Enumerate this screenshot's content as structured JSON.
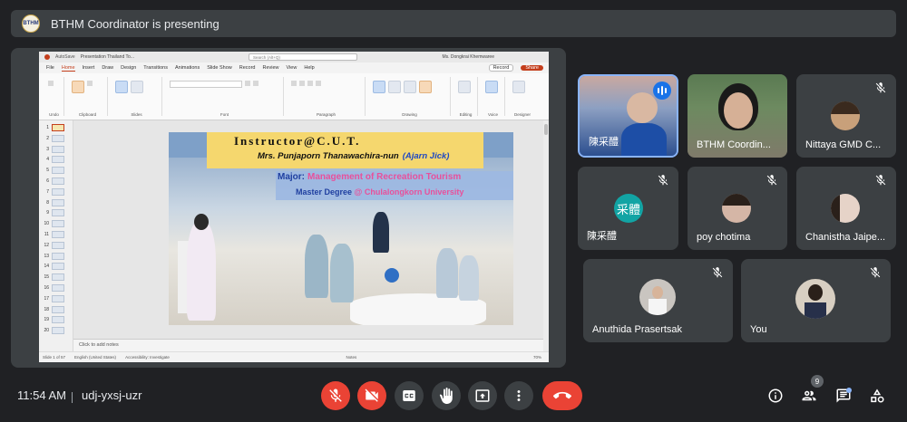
{
  "presenter": {
    "text": "BTHM Coordinator is presenting",
    "avatar_text": "BTHM"
  },
  "powerpoint": {
    "autosave": "AutoSave",
    "file_title": "Presentation Thailand To...",
    "search_placeholder": "Search (Alt+Q)",
    "user": "Ms. Dongkrai Khemwaree",
    "menu": [
      "File",
      "Home",
      "Insert",
      "Draw",
      "Design",
      "Transitions",
      "Animations",
      "Slide Show",
      "Record",
      "Review",
      "View",
      "Help"
    ],
    "active_menu": "Home",
    "record_label": "Record",
    "share_label": "Share",
    "ribbon_groups": [
      "Undo",
      "Clipboard",
      "Slides",
      "Font",
      "Paragraph",
      "Drawing",
      "Editing",
      "Voice",
      "Designer"
    ],
    "slide_numbers": [
      "1",
      "2",
      "3",
      "4",
      "5",
      "6",
      "7",
      "8",
      "9",
      "10",
      "11",
      "12",
      "13",
      "14",
      "15",
      "16",
      "17",
      "18",
      "19",
      "20"
    ],
    "notes_placeholder": "Click to add notes",
    "status": {
      "slide": "Slide 1 of 57",
      "language": "English (United States)",
      "accessibility": "Accessibility: Investigate",
      "notes": "Notes",
      "zoom": "70%"
    }
  },
  "slide": {
    "title": "Instructor@C.U.T.",
    "name": "Mrs. Punjaporn Thanawachira-nun",
    "nickname": "(Ajarn Jick)",
    "major_label": "Major:",
    "major_value": "Management of Recreation Tourism",
    "degree_label": "Master Degree",
    "degree_value": "@ Chulalongkorn University"
  },
  "participants": [
    {
      "name": "陳采醴",
      "speaking": true,
      "muted": false
    },
    {
      "name": "BTHM Coordin...",
      "speaking": false,
      "muted": false
    },
    {
      "name": "Nittaya GMD C...",
      "speaking": false,
      "muted": true
    },
    {
      "name": "陳采醴",
      "avatar_text": "采體",
      "speaking": false,
      "muted": true
    },
    {
      "name": "poy chotima",
      "speaking": false,
      "muted": true
    },
    {
      "name": "Chanistha Jaipe...",
      "speaking": false,
      "muted": true
    },
    {
      "name": "Anuthida Prasertsak",
      "speaking": false,
      "muted": true
    },
    {
      "name": "You",
      "speaking": false,
      "muted": true
    }
  ],
  "meeting": {
    "time": "11:54 AM",
    "code": "udj-yxsj-uzr",
    "participant_count": "9"
  },
  "colors": {
    "background": "#202124",
    "tile": "#3c4043",
    "danger": "#ea4335",
    "accent": "#8ab4f8"
  },
  "icons": [
    "mic-off-icon",
    "camera-off-icon",
    "captions-icon",
    "raise-hand-icon",
    "present-icon",
    "more-icon",
    "end-call-icon",
    "info-icon",
    "people-icon",
    "chat-icon",
    "activities-icon"
  ]
}
